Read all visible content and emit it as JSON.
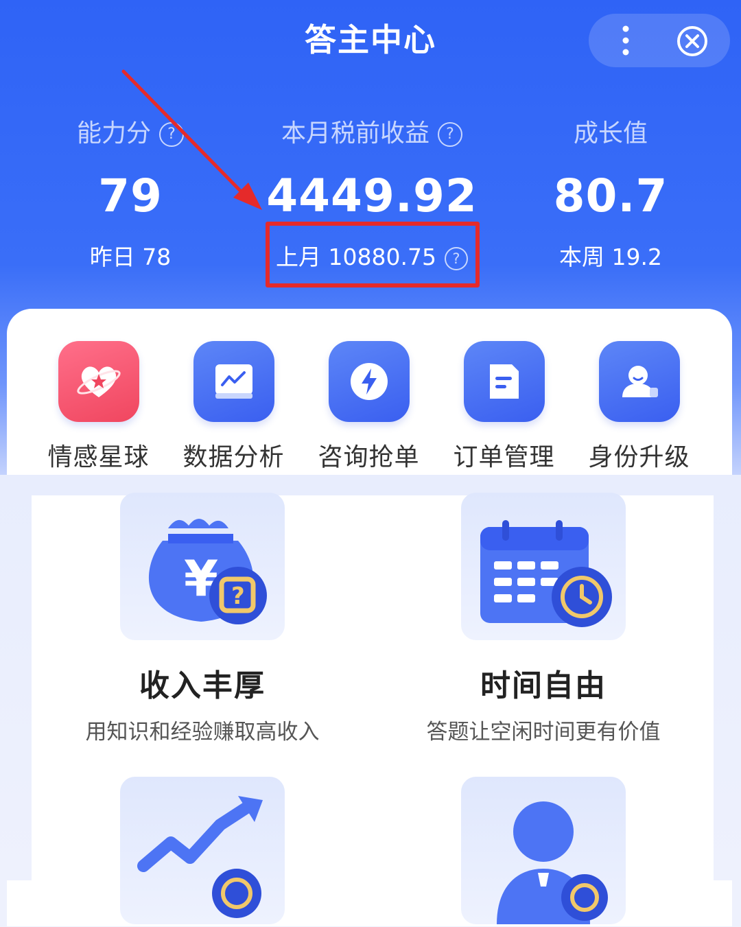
{
  "header": {
    "title": "答主中心",
    "more_icon": "more-vertical-icon",
    "close_icon": "close-circle-icon"
  },
  "stats": [
    {
      "label": "能力分",
      "value": "79",
      "sub": "昨日 78",
      "has_help": true
    },
    {
      "label": "本月税前收益",
      "value": "4449.92",
      "sub": "上月 10880.75",
      "has_help": true
    },
    {
      "label": "成长值",
      "value": "80.7",
      "sub": "本周 19.2",
      "has_help": false
    }
  ],
  "help_glyph": "?",
  "grid": [
    {
      "label": "情感星球",
      "icon": "heart-planet-icon"
    },
    {
      "label": "数据分析",
      "icon": "line-chart-icon"
    },
    {
      "label": "咨询抢单",
      "icon": "lightning-icon"
    },
    {
      "label": "订单管理",
      "icon": "document-icon"
    },
    {
      "label": "身份升级",
      "icon": "user-upgrade-icon"
    }
  ],
  "features": [
    {
      "title": "收入丰厚",
      "desc": "用知识和经验赚取高收入",
      "icon": "money-bag-icon"
    },
    {
      "title": "时间自由",
      "desc": "答题让空闲时间更有价值",
      "icon": "calendar-clock-icon"
    },
    {
      "title": "",
      "desc": "",
      "icon": "growth-chart-icon"
    },
    {
      "title": "",
      "desc": "",
      "icon": "person-icon"
    }
  ],
  "colors": {
    "header_blue": "#2f63f6",
    "highlight_red": "#e52a2a",
    "icon_blue": "#3a5ff0",
    "icon_pink": "#f0465f"
  }
}
